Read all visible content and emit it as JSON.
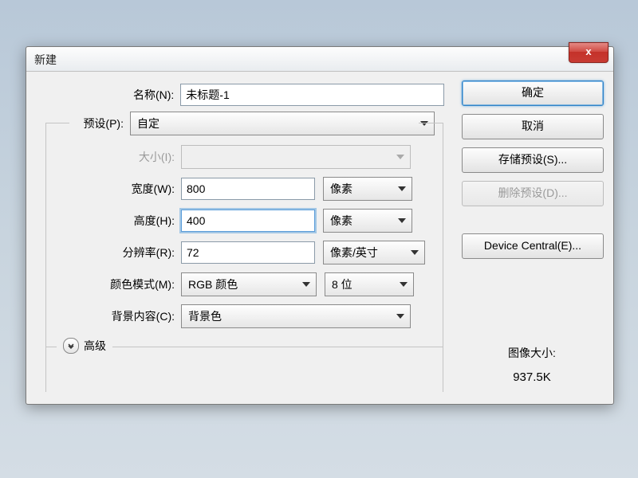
{
  "title": "新建",
  "close_glyph": "x",
  "labels": {
    "name": "名称(N):",
    "preset": "预设(P):",
    "size": "大小(I):",
    "width": "宽度(W):",
    "height": "高度(H):",
    "resolution": "分辨率(R):",
    "color_mode": "颜色模式(M):",
    "bg": "背景内容(C):",
    "advanced": "高级"
  },
  "fields": {
    "name": "未标题-1",
    "preset": "自定",
    "size": "",
    "width": "800",
    "width_unit": "像素",
    "height": "400",
    "height_unit": "像素",
    "resolution": "72",
    "resolution_unit": "像素/英寸",
    "color_mode": "RGB 颜色",
    "bit_depth": "8 位",
    "bg": "背景色"
  },
  "buttons": {
    "ok": "确定",
    "cancel": "取消",
    "save_preset": "存储预设(S)...",
    "delete_preset": "删除预设(D)...",
    "device_central": "Device Central(E)..."
  },
  "image_size": {
    "label": "图像大小:",
    "value": "937.5K"
  }
}
